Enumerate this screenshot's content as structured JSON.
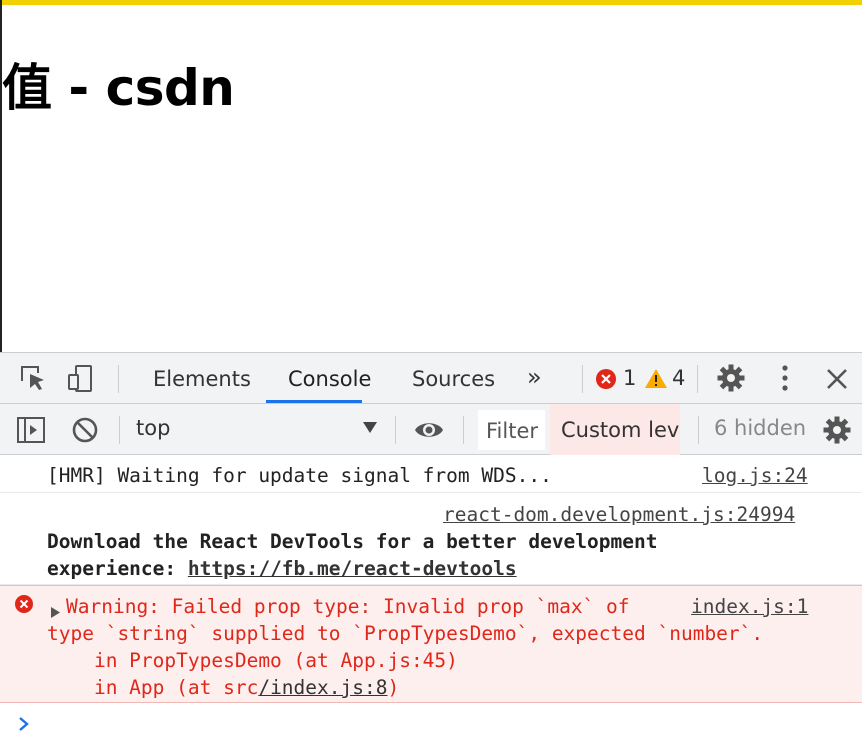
{
  "page": {
    "heading": "值 - csdn"
  },
  "devtools": {
    "tabs": {
      "elements": "Elements",
      "console": "Console",
      "sources": "Sources",
      "more": "»"
    },
    "counters": {
      "errors": "1",
      "warnings": "4"
    },
    "colors": {
      "accent_bar": "#f3d100",
      "active_tab": "#1a73e8",
      "error_text": "#e0271a",
      "error_bg": "#fcefee",
      "warning": "#f9ab00"
    },
    "toolbar": {
      "context": "top",
      "filter_placeholder": "Filter",
      "levels": "Custom leve",
      "hidden": "6 hidden"
    },
    "console": {
      "messages": [
        {
          "text": "[HMR] Waiting for update signal from WDS...",
          "source": "log.js:24"
        },
        {
          "source": "react-dom.development.js:24994",
          "line1": "Download the React DevTools for a better development",
          "line2_prefix": "experience: ",
          "link": "https://fb.me/react-devtools"
        },
        {
          "level": "error",
          "line1": "Warning: Failed prop type: Invalid prop `max` of",
          "source": "index.js:1",
          "line2": "type `string` supplied to `PropTypesDemo`, expected `number`.",
          "line3": "    in PropTypesDemo (at App.js:45)",
          "line4_prefix": "    in App (at src",
          "line4_link": "/index.js:8",
          "line4_suffix": ")"
        }
      ]
    },
    "icons": [
      "inspect-icon",
      "device-toolbar-icon",
      "error-icon",
      "warning-icon",
      "settings-icon",
      "kebab-menu-icon",
      "close-icon",
      "sidebar-toggle-icon",
      "clear-console-icon",
      "dropdown-arrow-icon",
      "eye-icon",
      "prompt-chevron-icon"
    ]
  }
}
